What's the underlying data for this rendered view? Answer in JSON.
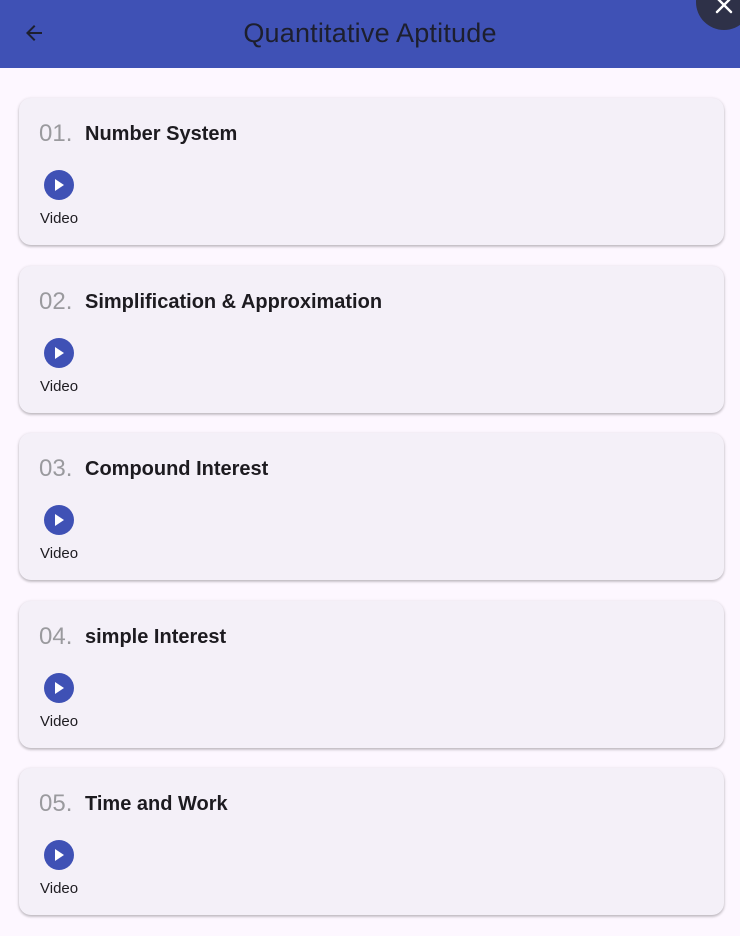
{
  "app_bar": {
    "title": "Quantitative Aptitude",
    "back_icon": "arrow-left-icon",
    "close_icon": "close-icon",
    "color": "#3f51b5"
  },
  "topics": [
    {
      "number": "01.",
      "title": "Number System",
      "media_label": "Video",
      "media_icon": "play-icon"
    },
    {
      "number": "02.",
      "title": "Simplification & Approximation",
      "media_label": "Video",
      "media_icon": "play-icon"
    },
    {
      "number": "03.",
      "title": "Compound Interest",
      "media_label": "Video",
      "media_icon": "play-icon"
    },
    {
      "number": "04.",
      "title": "simple Interest",
      "media_label": "Video",
      "media_icon": "play-icon"
    },
    {
      "number": "05.",
      "title": "Time and Work",
      "media_label": "Video",
      "media_icon": "play-icon"
    }
  ]
}
